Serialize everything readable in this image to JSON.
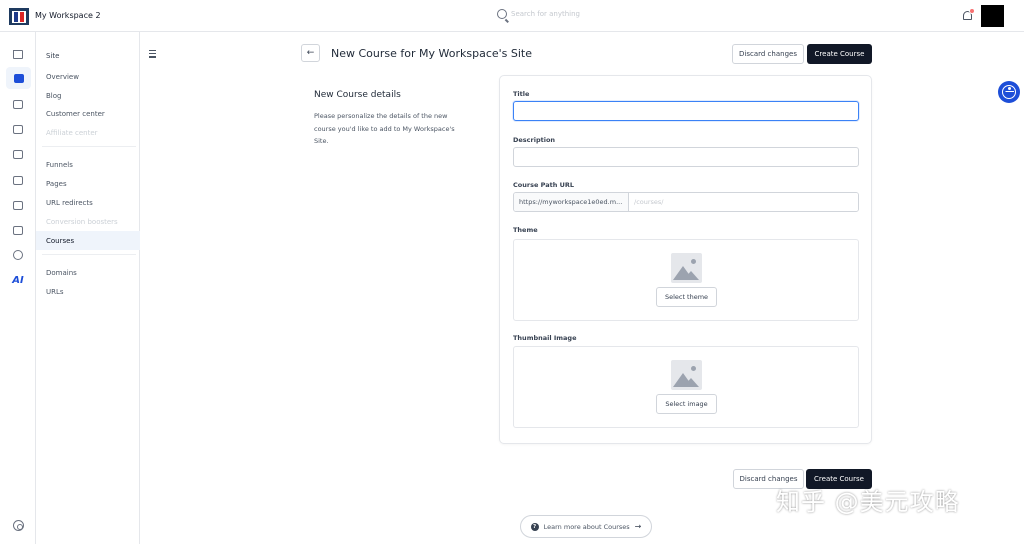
{
  "topbar": {
    "workspace_name": "My Workspace 2",
    "search_placeholder": "Search for anything"
  },
  "rail": {
    "icons": [
      "home-icon",
      "website-icon",
      "store-icon",
      "cart-icon",
      "contacts-icon",
      "analytics-icon",
      "email-icon",
      "automation-icon",
      "settings-icon",
      "ai-icon",
      "help-icon"
    ],
    "ai_label": "AI"
  },
  "subnav": {
    "section_site": "Site",
    "items_site": [
      "Overview",
      "Blog",
      "Customer center",
      "Affiliate center"
    ],
    "items_pages": [
      "Funnels",
      "Pages",
      "URL redirects",
      "Conversion boosters",
      "Courses"
    ],
    "items_domains": [
      "Domains",
      "URLs"
    ]
  },
  "header": {
    "title": "New Course for My Workspace's Site",
    "discard_label": "Discard changes",
    "create_label": "Create Course"
  },
  "details": {
    "title": "New Course details",
    "description": "Please personalize the details of the new course you'd like to add to My Workspace's Site."
  },
  "form": {
    "title_label": "Title",
    "title_value": "",
    "description_label": "Description",
    "description_value": "",
    "url_label": "Course Path URL",
    "url_prefix": "https://myworkspace1e0ed.m...",
    "url_placeholder": "/courses/",
    "theme_label": "Theme",
    "theme_button": "Select theme",
    "thumbnail_label": "Thumbnail Image",
    "thumbnail_button": "Select image"
  },
  "footer": {
    "discard_label": "Discard changes",
    "create_label": "Create Course",
    "learn_more": "Learn more about Courses",
    "watermark": "知乎 @美元攻略"
  },
  "colors": {
    "primary_dark": "#111827",
    "accent_blue": "#1d4ed8",
    "active_nav_bg": "#eff4fb",
    "notification_dot": "#f87171"
  }
}
